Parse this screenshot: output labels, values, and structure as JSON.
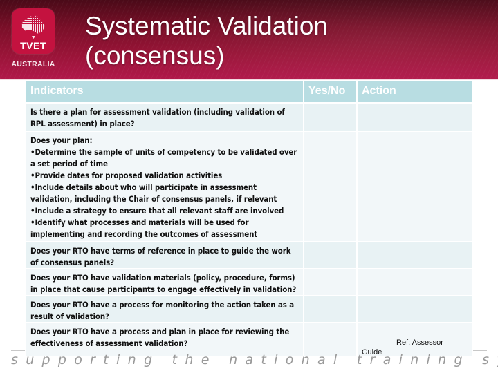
{
  "header": {
    "logo": {
      "icon": "australia-map-icon",
      "brand": "TVET",
      "subtitle": "AUSTRALIA"
    },
    "title_line1": "Systematic Validation",
    "title_line2": "(consensus)"
  },
  "table": {
    "columns": [
      "Indicators",
      "Yes/No",
      "Action"
    ],
    "rows": [
      {
        "indicator": "Is there a plan for assessment validation (including validation of RPL assessment) in place?",
        "yes_no": "",
        "action": ""
      },
      {
        "indicator_intro": "Does your plan:",
        "indicator_bullets": [
          "•Determine the sample of units of competency to be validated over a set period of time",
          "•Provide dates for proposed validation activities",
          "•Include details about who will participate in assessment validation, including the Chair of consensus panels, if relevant",
          "•Include a strategy to ensure that all relevant staff are involved",
          "•Identify what processes and materials will be used for implementing and recording the outcomes of assessment validation"
        ],
        "yes_no": "",
        "action": ""
      },
      {
        "indicator": "Does your RTO have terms of reference in place to guide the work of consensus panels?",
        "yes_no": "",
        "action": ""
      },
      {
        "indicator": "Does your RTO have validation materials (policy, procedure, forms) in place that cause participants to engage effectively in validation?",
        "yes_no": "",
        "action": ""
      },
      {
        "indicator": "Does your RTO have a process for monitoring the action taken as a result of validation?",
        "yes_no": "",
        "action": ""
      },
      {
        "indicator": "Does your RTO have a process and plan in place for reviewing the effectiveness of assessment validation?",
        "yes_no": "",
        "action_ref_line1": "Ref:  Assessor",
        "action_ref_line2": "Guide"
      }
    ]
  },
  "footer": {
    "tagline": "supporting the national training system"
  },
  "colors": {
    "header_maroon": "#8a1230",
    "logo_red": "#c4123f",
    "table_header": "#b8dde2",
    "row_odd": "#e8f2f4",
    "row_even": "#f2f7f9",
    "footer_text": "#9a9a9a"
  }
}
